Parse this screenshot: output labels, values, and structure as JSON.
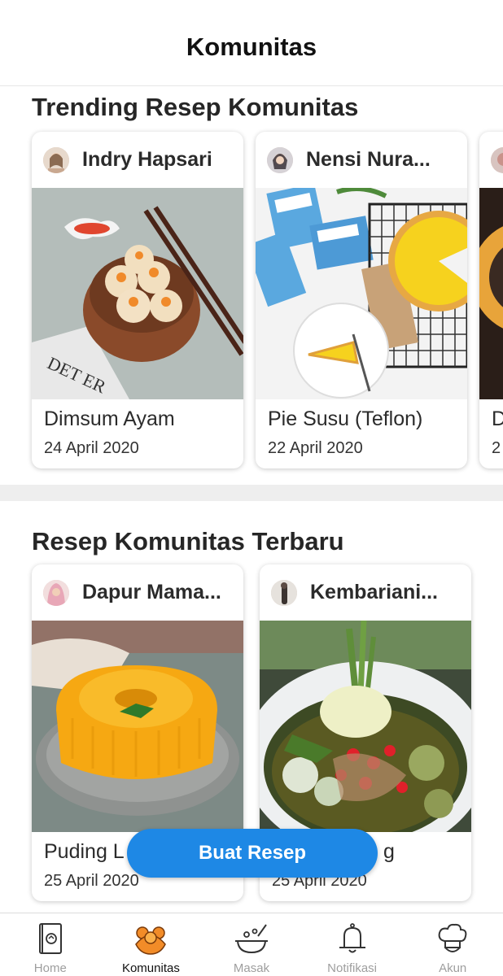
{
  "header": {
    "title": "Komunitas"
  },
  "trending": {
    "title": "Trending Resep Komunitas",
    "cards": [
      {
        "author": "Indry Hapsari",
        "title": "Dimsum Ayam",
        "date": "24 April 2020"
      },
      {
        "author": "Nensi Nura...",
        "title": "Pie Susu (Teflon)",
        "date": "22 April 2020"
      },
      {
        "author": "",
        "title": "D",
        "date": "2"
      }
    ]
  },
  "latest": {
    "title": "Resep Komunitas Terbaru",
    "cards": [
      {
        "author": "Dapur Mama...",
        "title": "Puding L",
        "date": "25 April 2020"
      },
      {
        "author": "Kembariani...",
        "title": "g",
        "date": "25 April 2020"
      }
    ]
  },
  "fab": {
    "label": "Buat Resep"
  },
  "nav": {
    "items": [
      {
        "label": "Home",
        "icon": "recipe-book-icon",
        "active": false
      },
      {
        "label": "Komunitas",
        "icon": "community-icon",
        "active": true
      },
      {
        "label": "Masak",
        "icon": "cooking-pot-icon",
        "active": false
      },
      {
        "label": "Notifikasi",
        "icon": "bell-icon",
        "active": false
      },
      {
        "label": "Akun",
        "icon": "chef-hat-icon",
        "active": false
      }
    ]
  },
  "colors": {
    "accent": "#1e88e5",
    "nav_active_icon": "#f28c28",
    "nav_inactive": "#9e9e9e"
  }
}
